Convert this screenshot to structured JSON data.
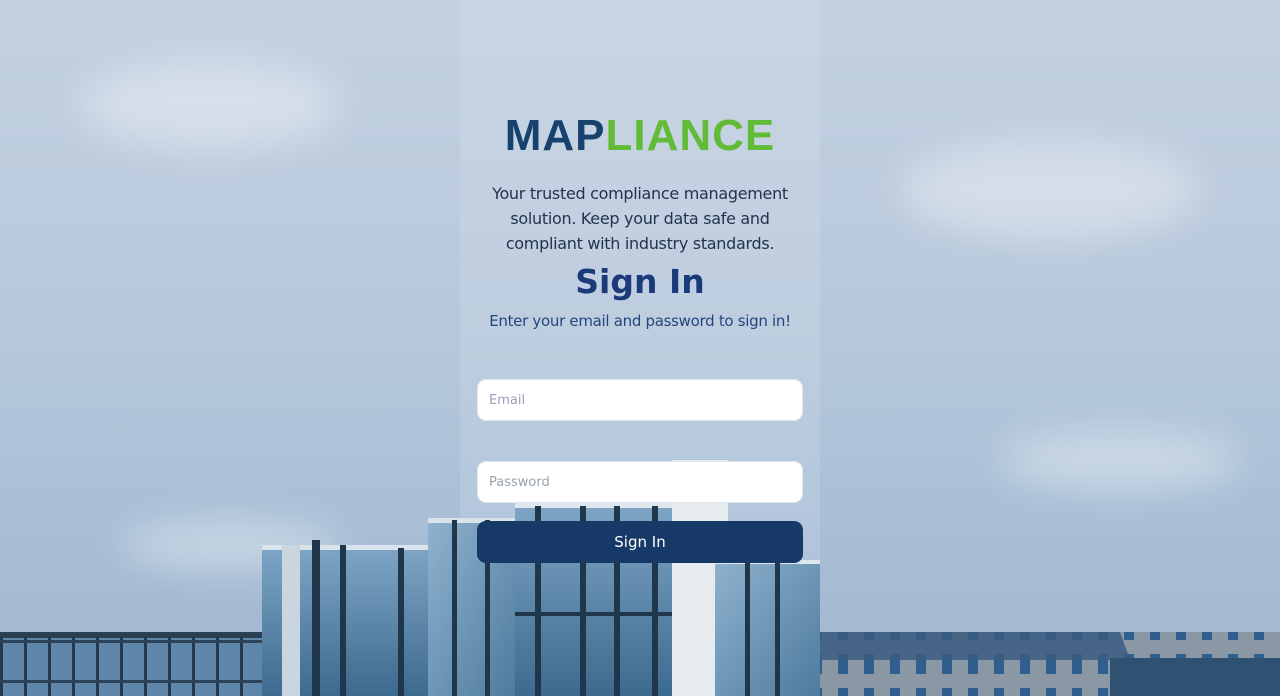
{
  "brand": {
    "logo_part1": "MAP",
    "logo_part2": "LIANCE"
  },
  "tagline": "Your trusted compliance management solution. Keep your data safe and compliant with industry standards.",
  "form": {
    "title": "Sign In",
    "subtitle": "Enter your email and password to sign in!",
    "email_placeholder": "Email",
    "password_placeholder": "Password",
    "submit_label": "Sign In"
  },
  "colors": {
    "brand_dark": "#17426d",
    "brand_green": "#62bb36",
    "button": "#163967",
    "title": "#1a3a7a"
  }
}
